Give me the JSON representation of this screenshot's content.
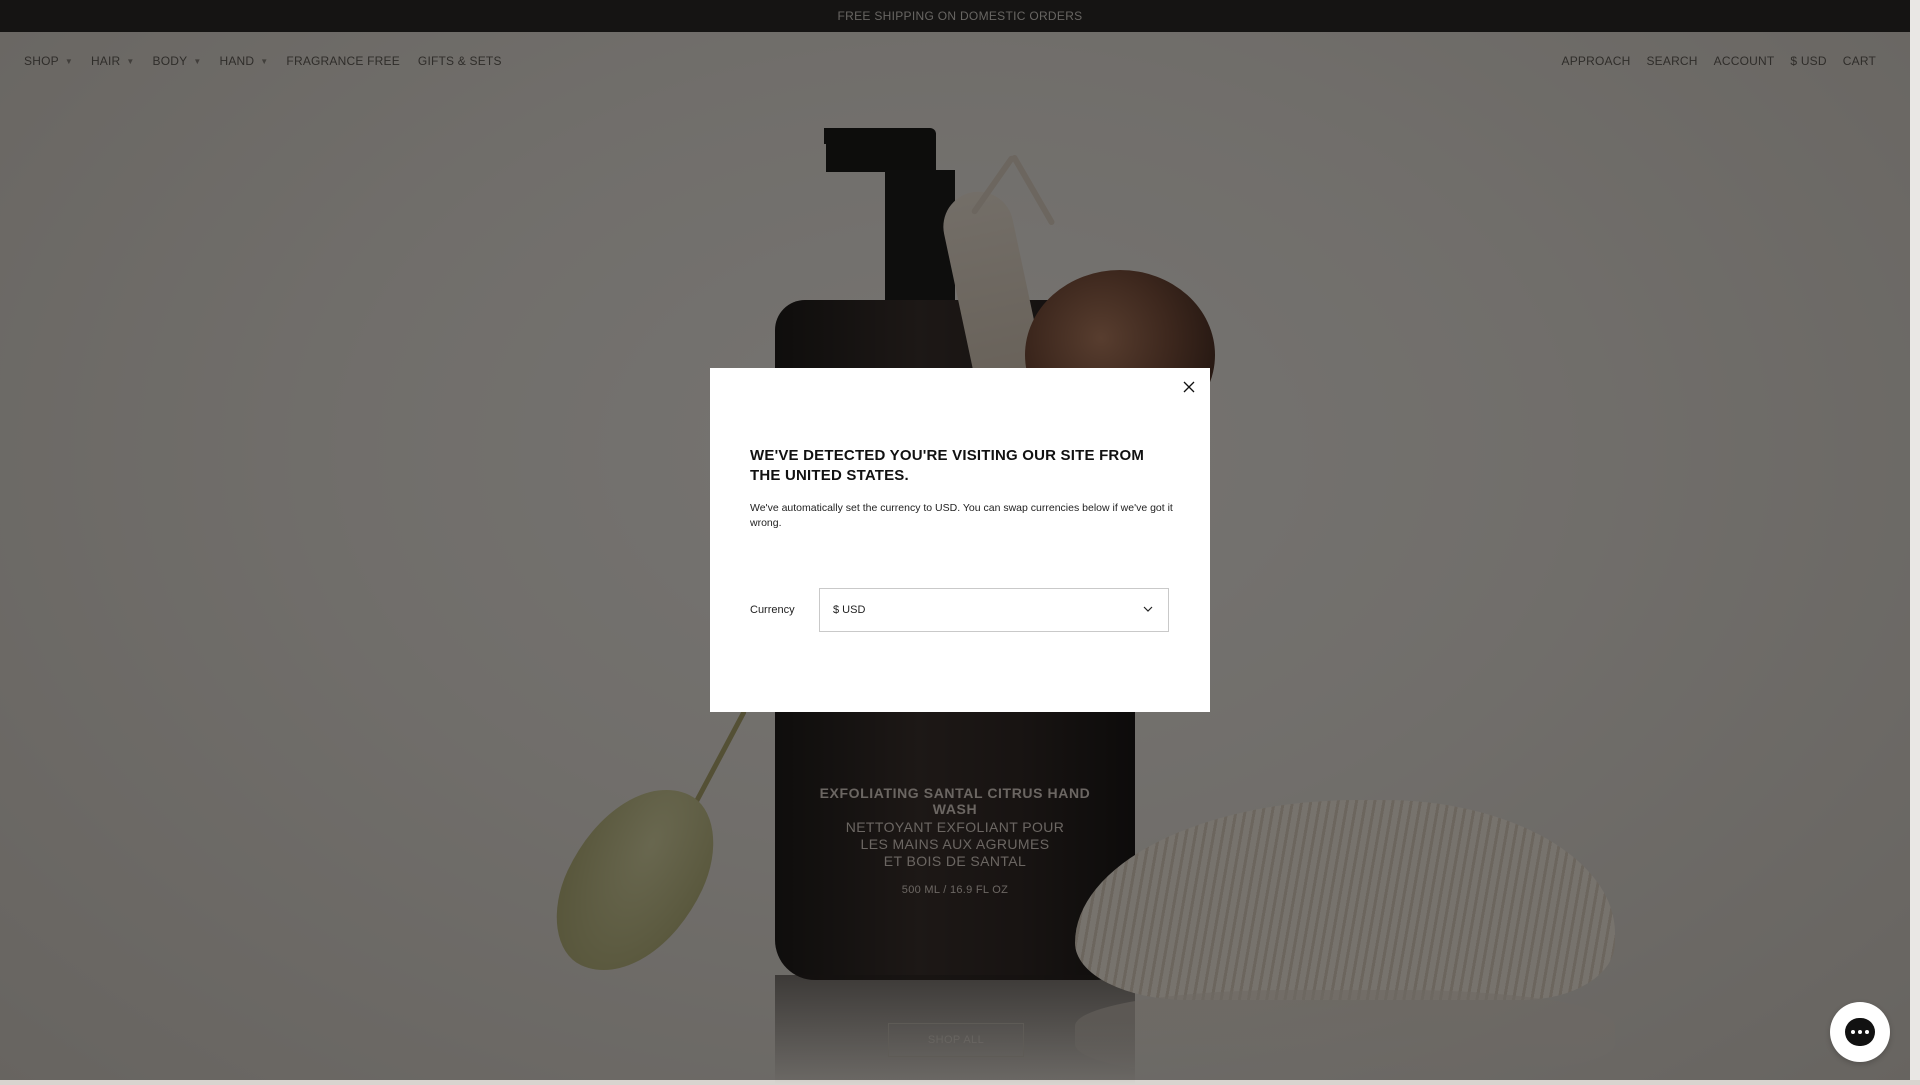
{
  "announcement": {
    "text": "FREE SHIPPING ON DOMESTIC ORDERS"
  },
  "nav": {
    "left": [
      {
        "label": "SHOP",
        "has_caret": true
      },
      {
        "label": "HAIR",
        "has_caret": true
      },
      {
        "label": "BODY",
        "has_caret": true
      },
      {
        "label": "HAND",
        "has_caret": true
      },
      {
        "label": "FRAGRANCE FREE",
        "has_caret": false
      },
      {
        "label": "GIFTS & SETS",
        "has_caret": false
      }
    ],
    "right": [
      "APPROACH",
      "SEARCH",
      "ACCOUNT",
      "$ USD",
      "CART"
    ]
  },
  "product_label": {
    "title": "EXFOLIATING SANTAL CITRUS HAND WASH",
    "french_1": "NETTOYANT EXFOLIANT POUR",
    "french_2": "LES MAINS AUX AGRUMES",
    "french_3": "ET BOIS DE SANTAL",
    "size": "500 ML / 16.9 FL OZ"
  },
  "hero": {
    "cta": "SHOP ALL"
  },
  "modal": {
    "title": "WE'VE DETECTED YOU'RE VISITING OUR SITE FROM THE UNITED STATES.",
    "body": "We've automatically set the currency to USD. You can swap currencies below if we've got it wrong.",
    "currency_label": "Currency",
    "selected_currency": "$ USD",
    "close_icon": "close-icon"
  },
  "chat": {
    "icon": "chat-icon"
  }
}
